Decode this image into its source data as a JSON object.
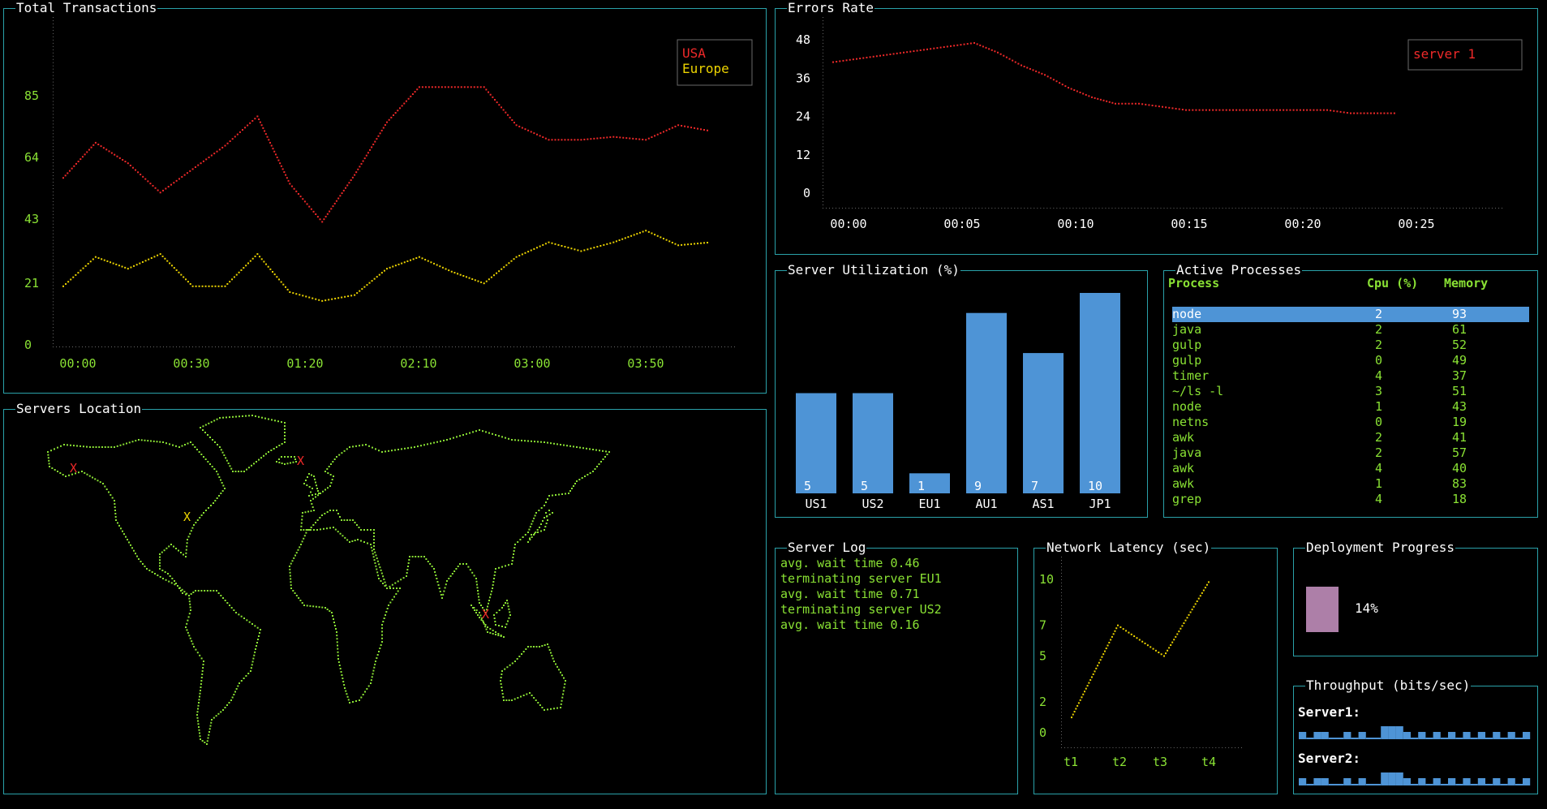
{
  "colors": {
    "border": "#2aa1a9",
    "green": "#8ae234",
    "red": "#ef2929",
    "yellow": "#edd400",
    "blue": "#4e94d6",
    "purple": "#ad7fa8"
  },
  "panels": {
    "total_transactions": "Total Transactions",
    "errors_rate": "Errors Rate",
    "servers_location": "Servers Location",
    "server_utilization": "Server Utilization (%)",
    "active_processes": "Active Processes",
    "server_log": "Server Log",
    "network_latency": "Network Latency (sec)",
    "deployment_progress": "Deployment Progress",
    "throughput": "Throughput (bits/sec)"
  },
  "chart_data": [
    {
      "id": "transactions",
      "type": "line",
      "x": [
        "00:00",
        "00:10",
        "00:20",
        "00:30",
        "00:40",
        "00:50",
        "01:00",
        "01:10",
        "01:20",
        "01:30",
        "01:40",
        "01:50",
        "02:00",
        "02:10",
        "02:20",
        "02:30",
        "02:40",
        "02:50",
        "03:00",
        "03:10",
        "03:20",
        "03:30",
        "03:40",
        "03:50",
        "04:00",
        "04:10",
        "04:20"
      ],
      "x_ticks": [
        "00:00",
        "00:30",
        "01:20",
        "02:10",
        "03:00",
        "03:50"
      ],
      "y_ticks": [
        "0",
        "21",
        "43",
        "64",
        "85"
      ],
      "ylim": [
        0,
        100
      ],
      "legend_position": "top-right",
      "series": [
        {
          "name": "USA",
          "color": "#ef2929",
          "values": [
            57,
            69,
            62,
            52,
            60,
            68,
            78,
            55,
            42,
            58,
            76,
            88,
            88,
            88,
            75,
            70,
            70,
            71,
            70,
            75,
            73
          ]
        },
        {
          "name": "Europe",
          "color": "#edd400",
          "values": [
            20,
            30,
            26,
            31,
            20,
            20,
            31,
            18,
            15,
            17,
            26,
            30,
            25,
            21,
            30,
            35,
            32,
            35,
            39,
            34,
            35
          ]
        }
      ]
    },
    {
      "id": "errors",
      "type": "line",
      "x_ticks": [
        "00:00",
        "00:05",
        "00:10",
        "00:15",
        "00:20",
        "00:25"
      ],
      "y_ticks": [
        "0",
        "12",
        "24",
        "36",
        "48"
      ],
      "ylim": [
        0,
        48
      ],
      "legend_position": "top-right",
      "series": [
        {
          "name": "server 1",
          "color": "#ef2929",
          "x": [
            0,
            1,
            2,
            3,
            4,
            5,
            6,
            7,
            8,
            9,
            10,
            11,
            12,
            13,
            14,
            15,
            16,
            17,
            18,
            19,
            20,
            21,
            22,
            23,
            24
          ],
          "values": [
            41,
            42,
            43,
            44,
            45,
            46,
            47,
            44,
            40,
            37,
            33,
            30,
            28,
            28,
            27,
            26,
            26,
            26,
            26,
            26,
            26,
            26,
            25,
            25,
            25
          ]
        }
      ]
    },
    {
      "id": "utilization",
      "type": "bar",
      "categories": [
        "US1",
        "US2",
        "EU1",
        "AU1",
        "AS1",
        "JP1"
      ],
      "values": [
        5,
        5,
        1,
        9,
        7,
        10
      ],
      "value_labels": [
        "5",
        "5",
        "1",
        "9",
        "7",
        "10"
      ],
      "ylim": [
        0,
        10
      ]
    },
    {
      "id": "latency",
      "type": "line",
      "x_ticks": [
        "t1",
        "t2",
        "t3",
        "t4"
      ],
      "y_ticks": [
        "0",
        "2",
        "5",
        "7",
        "10"
      ],
      "ylim": [
        0,
        10
      ],
      "series": [
        {
          "color": "#edd400",
          "x": [
            0,
            1,
            2,
            3
          ],
          "values": [
            1,
            7,
            5,
            10
          ]
        }
      ]
    },
    {
      "id": "throughput",
      "type": "bar",
      "series": [
        {
          "name": "Server1:",
          "values": [
            1,
            0,
            1,
            1,
            0,
            0,
            1,
            0,
            1,
            0,
            0,
            2,
            2,
            2,
            1,
            0,
            1,
            0,
            1,
            0,
            1,
            0,
            1,
            0,
            1,
            0,
            1,
            0,
            1,
            0,
            1
          ]
        },
        {
          "name": "Server2:",
          "values": [
            1,
            0,
            1,
            1,
            0,
            0,
            1,
            0,
            1,
            0,
            0,
            2,
            2,
            2,
            1,
            0,
            1,
            0,
            1,
            0,
            1,
            0,
            1,
            0,
            1,
            0,
            1,
            0,
            1,
            0,
            1
          ]
        }
      ]
    }
  ],
  "processes": {
    "headers": [
      "Process",
      "Cpu (%)",
      "Memory"
    ],
    "selected_index": 0,
    "rows": [
      [
        "node",
        "2",
        "93"
      ],
      [
        "java",
        "2",
        "61"
      ],
      [
        "gulp",
        "2",
        "52"
      ],
      [
        "gulp",
        "0",
        "49"
      ],
      [
        "timer",
        "4",
        "37"
      ],
      [
        "~/ls -l",
        "3",
        "51"
      ],
      [
        "node",
        "1",
        "43"
      ],
      [
        "netns",
        "0",
        "19"
      ],
      [
        "awk",
        "2",
        "41"
      ],
      [
        "java",
        "2",
        "57"
      ],
      [
        "awk",
        "4",
        "40"
      ],
      [
        "awk",
        "1",
        "83"
      ],
      [
        "grep",
        "4",
        "18"
      ]
    ]
  },
  "server_log": [
    "avg. wait time 0.46",
    "terminating server EU1",
    "avg. wait time 0.71",
    "terminating server US2",
    "avg. wait time 0.16"
  ],
  "deployment": {
    "progress": 0.14,
    "label": "14%"
  },
  "map_markers": [
    {
      "glyph": "X",
      "color": "#ef2929",
      "lon": -150,
      "lat": 61
    },
    {
      "glyph": "X",
      "color": "#edd400",
      "lon": -80,
      "lat": 41
    },
    {
      "glyph": "X",
      "color": "#ef2929",
      "lon": -10,
      "lat": 64
    },
    {
      "glyph": "X",
      "color": "#ef2929",
      "lon": 104,
      "lat": 1
    }
  ]
}
